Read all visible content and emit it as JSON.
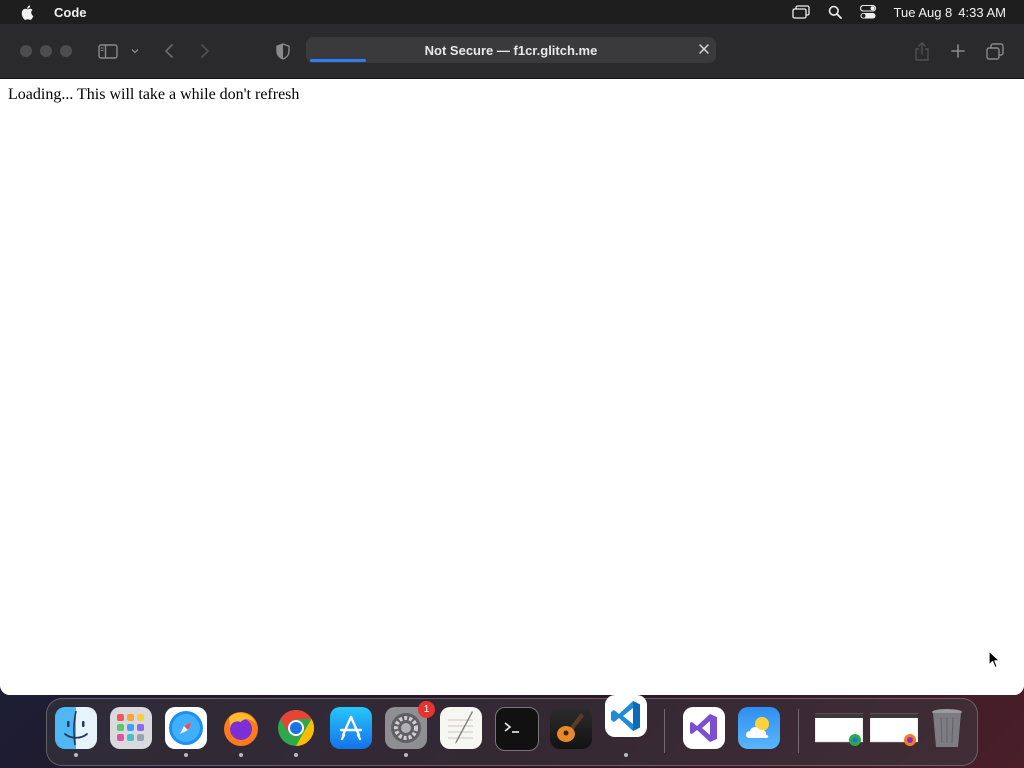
{
  "menubar": {
    "app_name": "Code",
    "date": "Tue Aug 8",
    "time": "4:33 AM"
  },
  "browser": {
    "url_text": "Not Secure — f1cr.glitch.me"
  },
  "page": {
    "loading_text": "Loading... This will take a while don't refresh"
  },
  "dock": {
    "settings_badge": "1"
  }
}
